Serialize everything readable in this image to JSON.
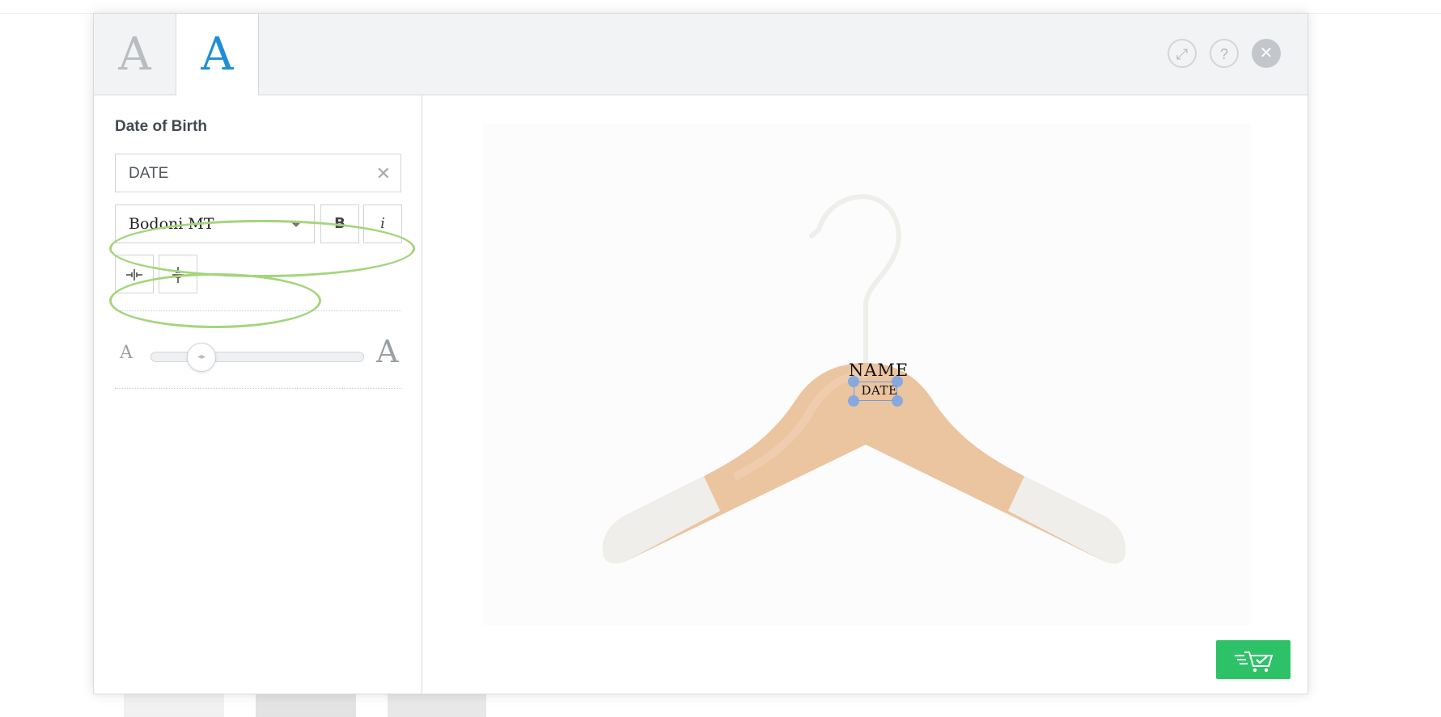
{
  "header": {
    "tabs": [
      {
        "glyph": "A",
        "active": false
      },
      {
        "glyph": "A",
        "active": true
      }
    ],
    "buttons": {
      "expand_icon": "⤢",
      "help_icon": "?",
      "close_icon": "✕"
    }
  },
  "sidebar": {
    "field_label": "Date of Birth",
    "text_input": {
      "value": "DATE",
      "clear_icon": "✕"
    },
    "font_select": {
      "value": "Bodoni MT"
    },
    "bold_label": "B",
    "italic_label": "i",
    "align_h_icon": "⊣⊢",
    "align_v_icon": "÷",
    "size": {
      "small_label": "A",
      "large_label": "A",
      "knob_icon": "◂▸"
    }
  },
  "preview": {
    "engraving_lines": [
      "NAME",
      "DATE"
    ]
  },
  "cart_button_icon": "🛒",
  "colors": {
    "accent": "#1f8fd4",
    "cart": "#2dc268",
    "annotation": "#a4d57c",
    "selection": "#7da6e3"
  }
}
